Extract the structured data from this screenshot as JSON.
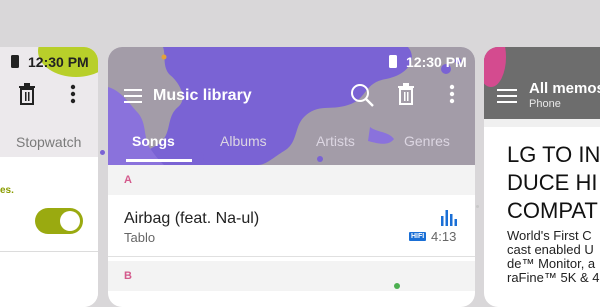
{
  "left_card": {
    "status_time": "12:30 PM",
    "tab_label": "Stopwatch",
    "setting_text": "es.",
    "toggle_on": true,
    "accent_color": "#b8cf2a"
  },
  "center_card": {
    "status_time": "12:30 PM",
    "title": "Music library",
    "tabs": [
      {
        "label": "Songs",
        "active": true
      },
      {
        "label": "Albums",
        "active": false
      },
      {
        "label": "Artists",
        "active": false
      },
      {
        "label": "Genres",
        "active": false
      }
    ],
    "sections": [
      "A",
      "B"
    ],
    "songs": [
      {
        "title": "Airbag (feat. Na-ul)",
        "artist": "Tablo",
        "badge": "HIFI",
        "duration": "4:13"
      }
    ],
    "accent_color": "#7a63d4"
  },
  "right_card": {
    "title": "All memos",
    "subtitle": "Phone",
    "headline_lines": [
      "LG TO IN",
      "DUCE HI",
      "COMPAT"
    ],
    "body_lines": [
      "World's First C",
      "cast enabled U",
      "de™ Monitor, a",
      "raFine™ 5K & 4"
    ],
    "accent_color": "#d44b8f"
  }
}
